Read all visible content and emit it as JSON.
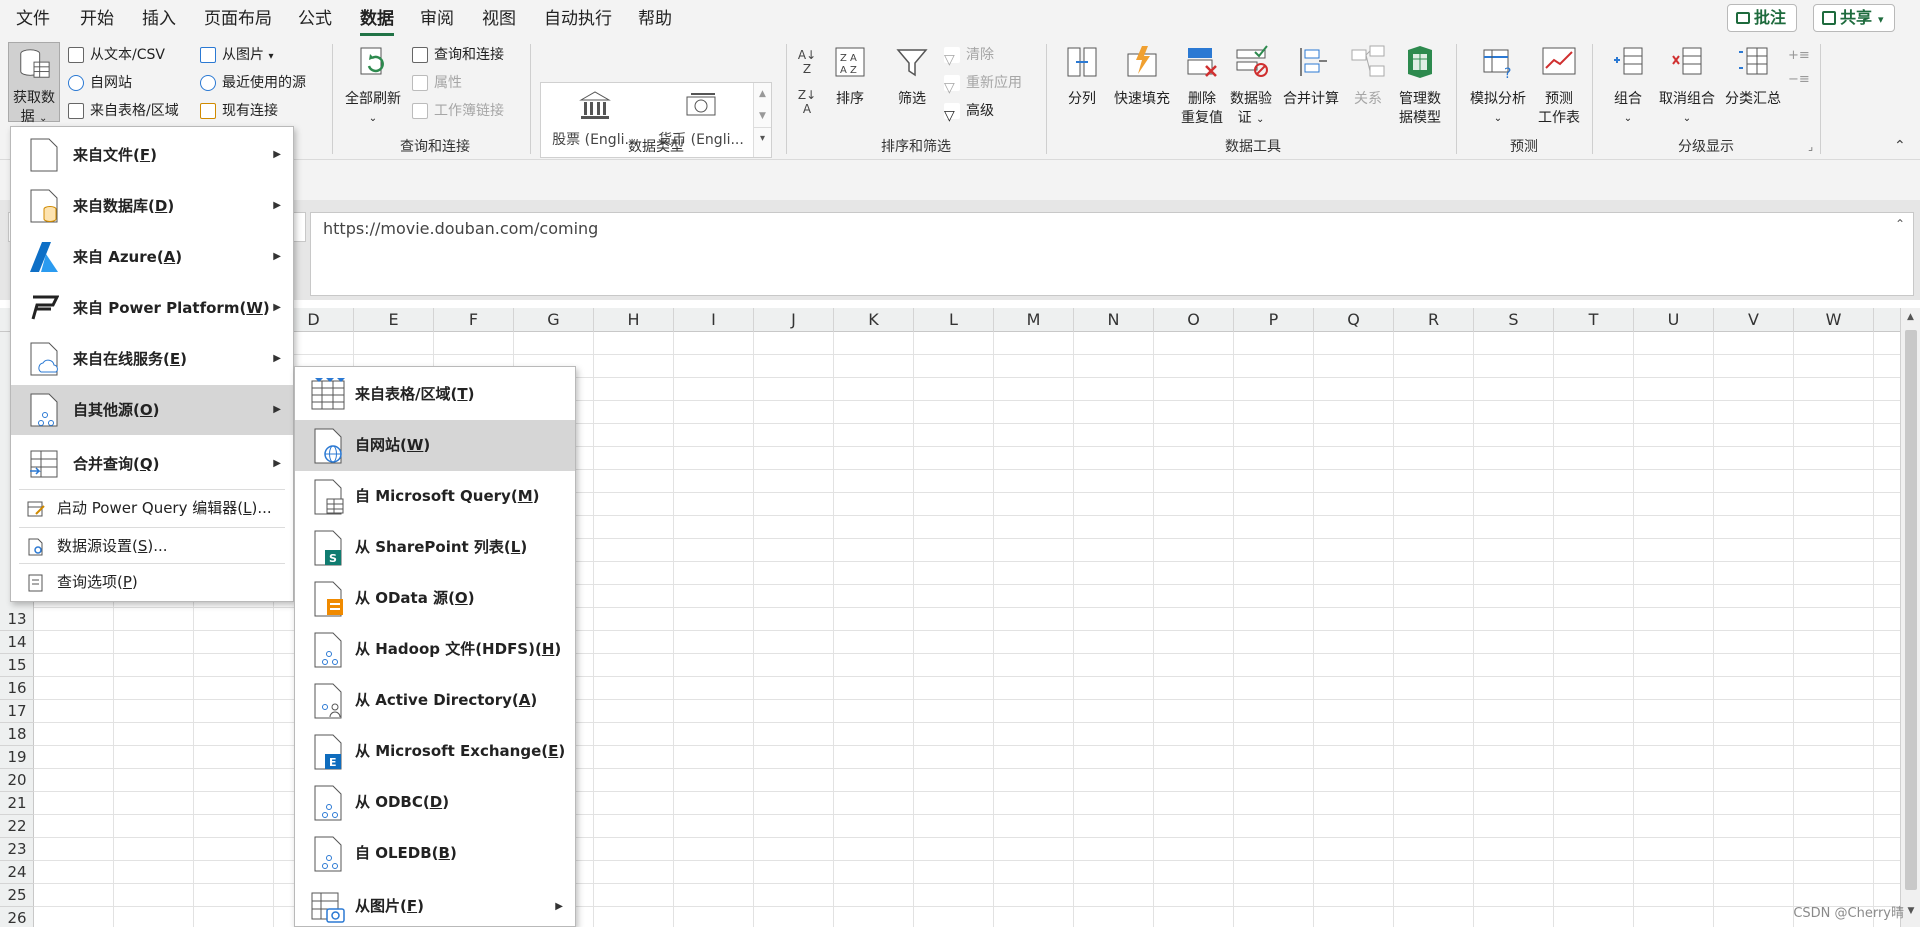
{
  "menubar": {
    "tabs": [
      "文件",
      "开始",
      "插入",
      "页面布局",
      "公式",
      "数据",
      "审阅",
      "视图",
      "自动执行",
      "帮助"
    ],
    "active_tab": "数据",
    "comment_btn": "批注",
    "share_btn": "共享"
  },
  "ribbon": {
    "get_data": {
      "line1": "获取数",
      "line2": "据"
    },
    "get_group": {
      "from_text_csv": "从文本/CSV",
      "from_web": "自网站",
      "from_table": "来自表格/区域",
      "from_picture": "从图片",
      "recent_sources": "最近使用的源",
      "existing_conn": "现有连接"
    },
    "query_group": {
      "refresh_all": "全部刷新",
      "queries_conn": "查询和连接",
      "properties": "属性",
      "edit_links": "工作簿链接",
      "label": "查询和连接"
    },
    "datatype_group": {
      "stocks": "股票 (Engli...",
      "currency": "货币 (Engli...",
      "label": "数据类型"
    },
    "sort_group": {
      "sort": "排序",
      "filter": "筛选",
      "clear": "清除",
      "reapply": "重新应用",
      "advanced": "高级",
      "label": "排序和筛选"
    },
    "tools_group": {
      "split": "分列",
      "flash_fill": "快速填充",
      "remove_dup_1": "删除",
      "remove_dup_2": "重复值",
      "validation_1": "数据验",
      "validation_2": "证",
      "consolidate": "合并计算",
      "relations": "关系",
      "data_model_1": "管理数",
      "data_model_2": "据模型",
      "label": "数据工具"
    },
    "forecast_group": {
      "whatif": "模拟分析",
      "forecast_1": "预测",
      "forecast_2": "工作表",
      "label": "预测"
    },
    "outline_group": {
      "group": "组合",
      "ungroup": "取消组合",
      "subtotal": "分类汇总",
      "label": "分级显示"
    }
  },
  "formula_bar": {
    "value": "https://movie.douban.com/coming"
  },
  "columns": [
    "D",
    "E",
    "F",
    "G",
    "H",
    "I",
    "J",
    "K",
    "L",
    "M",
    "N",
    "O",
    "P",
    "Q",
    "R",
    "S",
    "T",
    "U",
    "V",
    "W"
  ],
  "rows": [
    "13",
    "14",
    "15",
    "16",
    "17",
    "18",
    "19",
    "20",
    "21",
    "22",
    "23",
    "24",
    "25",
    "26"
  ],
  "menu1": {
    "items": [
      {
        "label": "来自文件",
        "key": "F"
      },
      {
        "label": "来自数据库",
        "key": "D"
      },
      {
        "label": "来自 Azure",
        "key": "A"
      },
      {
        "label": "来自 Power Platform",
        "key": "W"
      },
      {
        "label": "来自在线服务",
        "key": "E"
      },
      {
        "label": "自其他源",
        "key": "O"
      },
      {
        "label": "合并查询",
        "key": "Q"
      }
    ],
    "launch_pq": {
      "label": "启动 Power Query 编辑器",
      "key": "L",
      "suffix": "..."
    },
    "ds_settings": {
      "label": "数据源设置",
      "key": "S",
      "suffix": "..."
    },
    "query_options": {
      "label": "查询选项",
      "key": "P",
      "suffix": ""
    }
  },
  "menu2": {
    "items": [
      {
        "label": "来自表格/区域",
        "key": "T"
      },
      {
        "label": "自网站",
        "key": "W"
      },
      {
        "label": "自 Microsoft Query",
        "key": "M"
      },
      {
        "label": "从 SharePoint 列表",
        "key": "L"
      },
      {
        "label": "从 OData 源",
        "key": "O"
      },
      {
        "label": "从 Hadoop 文件(HDFS)",
        "key": "H"
      },
      {
        "label": "从 Active Directory",
        "key": "A"
      },
      {
        "label": "从 Microsoft Exchange",
        "key": "E"
      },
      {
        "label": "从 ODBC",
        "key": "D"
      },
      {
        "label": "自 OLEDB",
        "key": "B"
      },
      {
        "label": "从图片",
        "key": "F"
      }
    ]
  },
  "colors": {
    "accent": "#217346",
    "highlight": "#d6d6d6",
    "web_icon": "#2b79d3"
  },
  "watermark": "CSDN @Cherry晴"
}
